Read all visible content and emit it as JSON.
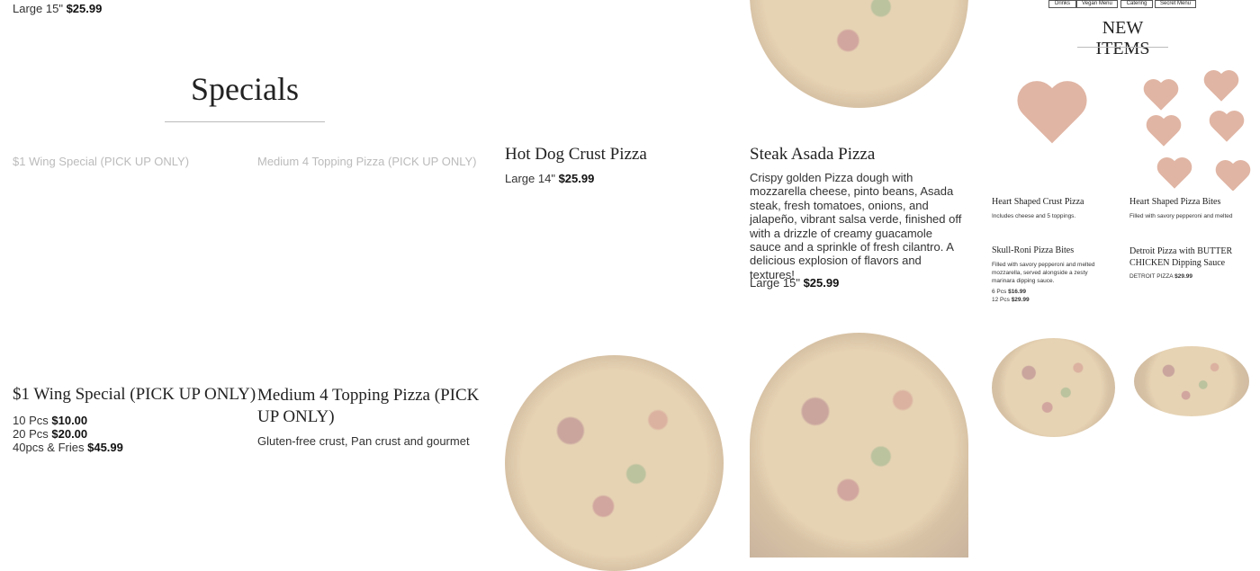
{
  "top_left_price": {
    "size": "Large 15\"",
    "price": "$25.99"
  },
  "specials": {
    "title": "Specials"
  },
  "wing_special": {
    "alt": "$1 Wing Special (PICK UP ONLY)",
    "title": "$1 Wing Special (PICK UP ONLY)",
    "prices": [
      {
        "size": "10 Pcs",
        "price": "$10.00"
      },
      {
        "size": "20 Pcs",
        "price": "$20.00"
      },
      {
        "size": "40pcs & Fries",
        "price": "$45.99"
      }
    ]
  },
  "medium_special": {
    "alt": "Medium 4 Topping Pizza (PICK UP ONLY)",
    "title": "Medium 4 Topping Pizza (PICK UP ONLY)",
    "description": "Gluten-free crust, Pan crust and gourmet"
  },
  "hot_dog": {
    "title": "Hot Dog Crust Pizza",
    "size": "Large 14\"",
    "price": "$25.99"
  },
  "steak_asada": {
    "title": "Steak Asada Pizza",
    "description": "Crispy golden Pizza dough with mozzarella cheese, pinto beans, Asada steak, fresh tomatoes, onions, and jalapeño, vibrant salsa verde, finished off with a drizzle of creamy guacamole sauce and a sprinkle of fresh cilantro. A delicious explosion of flavors and textures!",
    "size": "Large 15\"",
    "price": "$25.99"
  },
  "menu_buttons": [
    "Drinks",
    "Vegan Menu",
    "Catering",
    "Secret Menu"
  ],
  "new_items": {
    "title": "NEW ITEMS",
    "cards": [
      {
        "title": "Heart Shaped Crust Pizza",
        "desc": "Includes cheese and 5 toppings."
      },
      {
        "title": "Heart Shaped Pizza Bites",
        "desc": "Filled with savory pepperoni and melted"
      },
      {
        "title": "Skull-Roni Pizza Bites",
        "desc": "Filled with savory pepperoni and melted mozzarella, served alongside a zesty marinara dipping sauce.",
        "lines": [
          {
            "size": "6 Pcs",
            "price": "$16.99"
          },
          {
            "size": "12 Pcs",
            "price": "$29.99"
          }
        ]
      },
      {
        "title": "Detroit Pizza with BUTTER CHICKEN Dipping Sauce",
        "size": "DETROIT PIZZA",
        "price": "$29.99"
      }
    ]
  }
}
